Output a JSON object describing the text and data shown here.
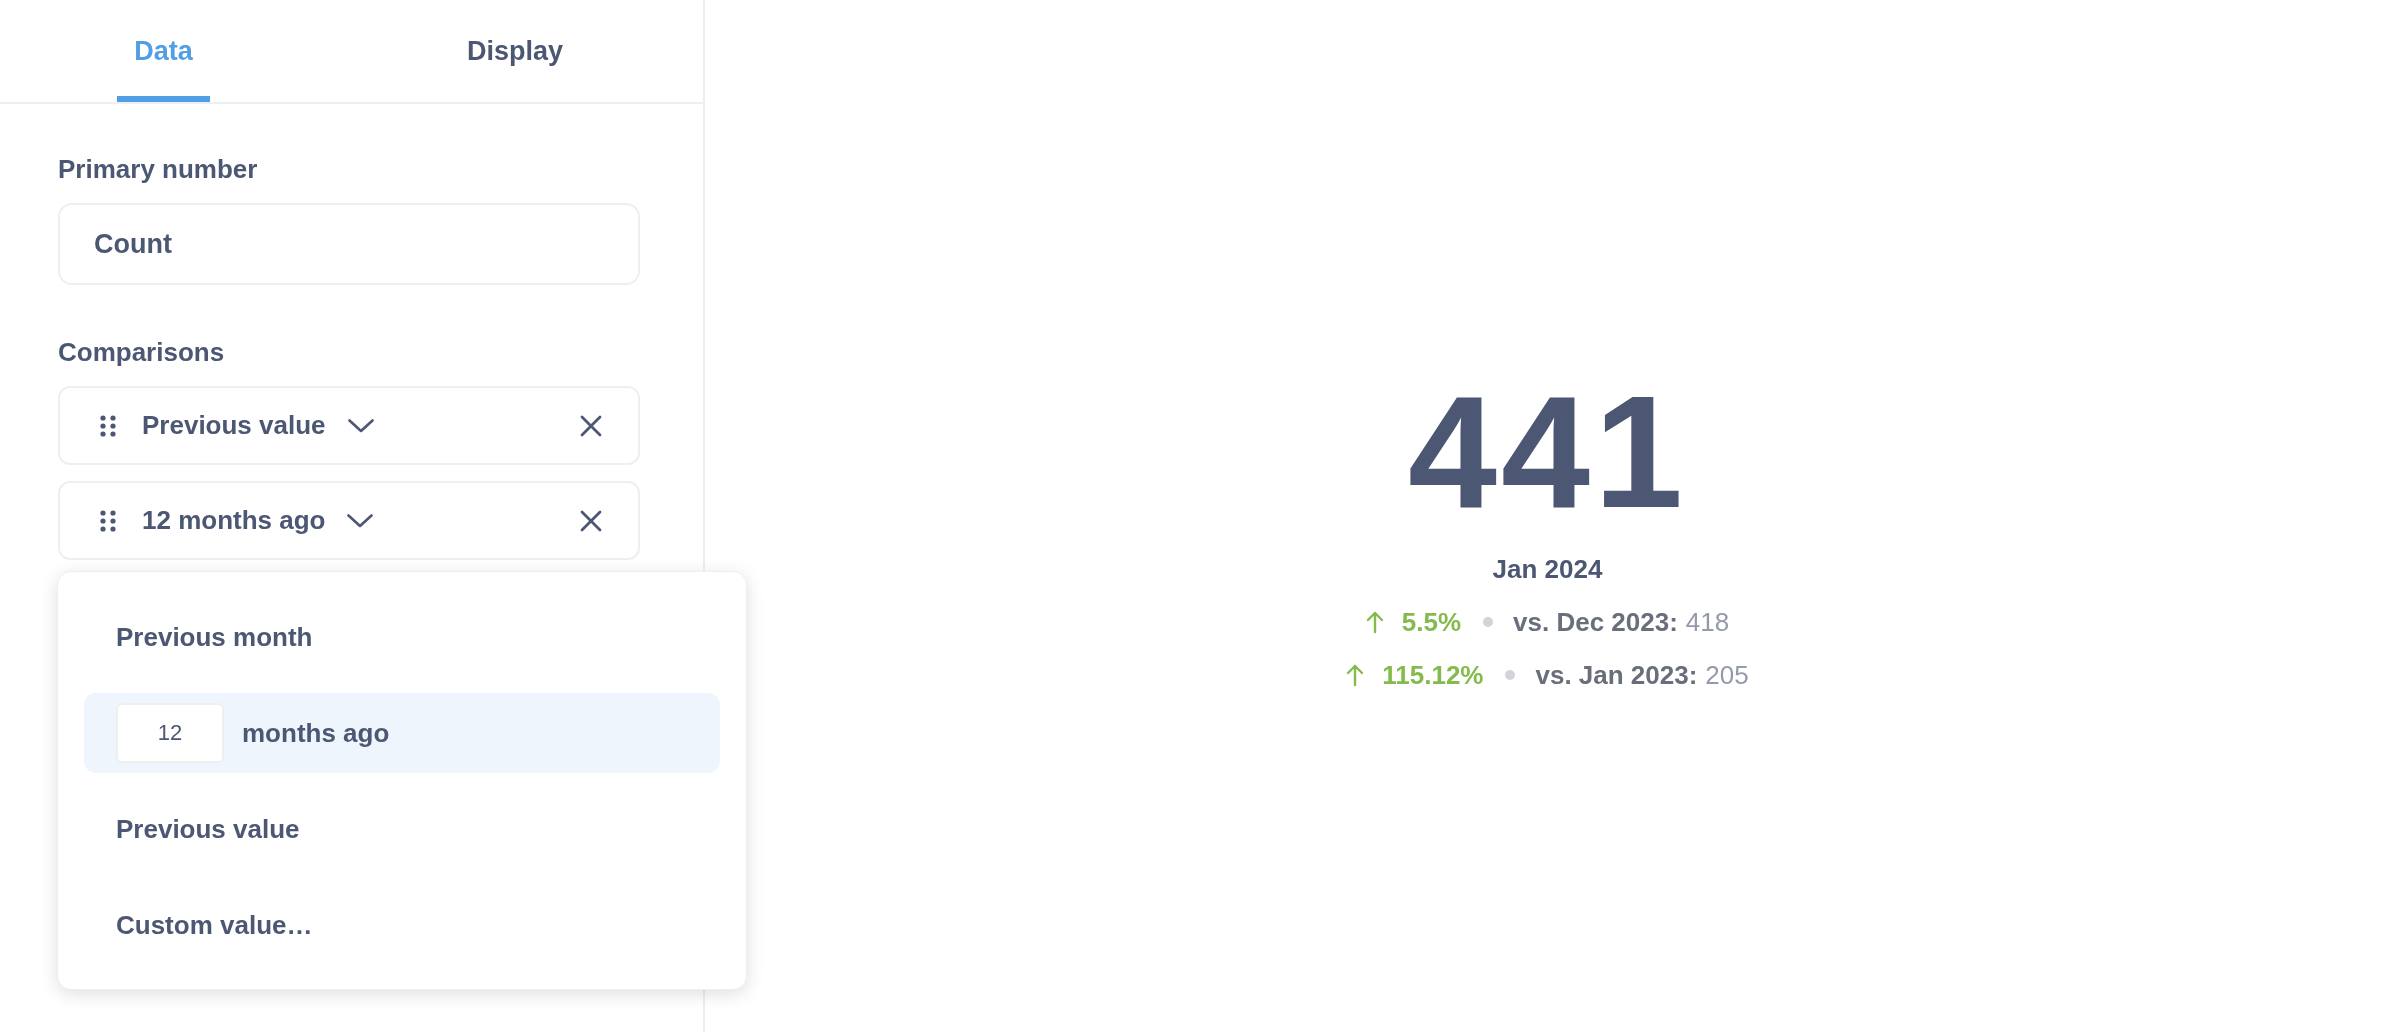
{
  "tabs": [
    {
      "label": "Data",
      "selected": true
    },
    {
      "label": "Display",
      "selected": false
    }
  ],
  "primary_number": {
    "label": "Primary number",
    "value": "Count"
  },
  "comparisons": {
    "label": "Comparisons",
    "items": [
      {
        "label": "Previous value"
      },
      {
        "label": "12 months ago"
      }
    ]
  },
  "dropdown": {
    "items": [
      {
        "kind": "option",
        "label": "Previous month",
        "selected": false
      },
      {
        "kind": "period",
        "value": "12",
        "label": "months ago",
        "selected": true
      },
      {
        "kind": "option",
        "label": "Previous value",
        "selected": false
      },
      {
        "kind": "option",
        "label": "Custom value…",
        "selected": false
      }
    ]
  },
  "scalar": {
    "value": "441",
    "period": "Jan 2024",
    "comparisons": [
      {
        "increase": true,
        "change": "5.5%",
        "label": "vs. Dec 2023:",
        "value": "418"
      },
      {
        "increase": true,
        "change": "115.12%",
        "label": "vs. Jan 2023:",
        "value": "205"
      }
    ]
  }
}
